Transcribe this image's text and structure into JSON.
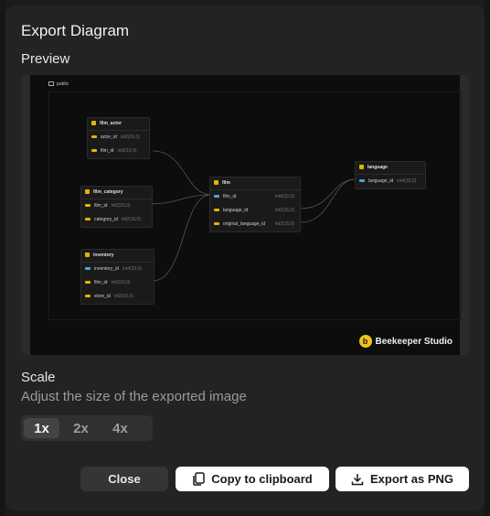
{
  "dialog": {
    "title": "Export Diagram",
    "preview_label": "Preview",
    "scale_title": "Scale",
    "scale_subtitle": "Adjust the size of the exported image"
  },
  "preview": {
    "schema": "public",
    "tables": [
      {
        "name": "film_actor",
        "columns": [
          {
            "name": "actor_id",
            "type": "int2(16,0)",
            "key": "pk"
          },
          {
            "name": "film_id",
            "type": "int2(16,0)",
            "key": "pk"
          }
        ]
      },
      {
        "name": "film_category",
        "columns": [
          {
            "name": "film_id",
            "type": "int2(16,0)",
            "key": "pk"
          },
          {
            "name": "category_id",
            "type": "int2(16,0)",
            "key": "pk"
          }
        ]
      },
      {
        "name": "inventory",
        "columns": [
          {
            "name": "inventory_id",
            "type": "int4(32,0)",
            "key": "fk"
          },
          {
            "name": "film_id",
            "type": "int2(16,0)",
            "key": "pk"
          },
          {
            "name": "store_id",
            "type": "int2(16,0)",
            "key": "pk"
          }
        ]
      },
      {
        "name": "film",
        "columns": [
          {
            "name": "film_id",
            "type": "int4(32,0)",
            "key": "fk"
          },
          {
            "name": "language_id",
            "type": "int2(16,0)",
            "key": "pk"
          },
          {
            "name": "original_language_id",
            "type": "int2(16,0)",
            "key": "pk"
          }
        ]
      },
      {
        "name": "language",
        "columns": [
          {
            "name": "language_id",
            "type": "int4(32,0)",
            "key": "fk"
          }
        ]
      }
    ],
    "brand": "Beekeeper Studio",
    "brand_logo_letter": "b"
  },
  "scale": {
    "options": [
      "1x",
      "2x",
      "4x"
    ],
    "selected": "1x"
  },
  "buttons": {
    "close": "Close",
    "copy": "Copy to clipboard",
    "export": "Export as PNG"
  },
  "colors": {
    "primary_key": "#e6b400",
    "foreign_key": "#4aa3df",
    "brand_yellow": "#f2c21b"
  }
}
